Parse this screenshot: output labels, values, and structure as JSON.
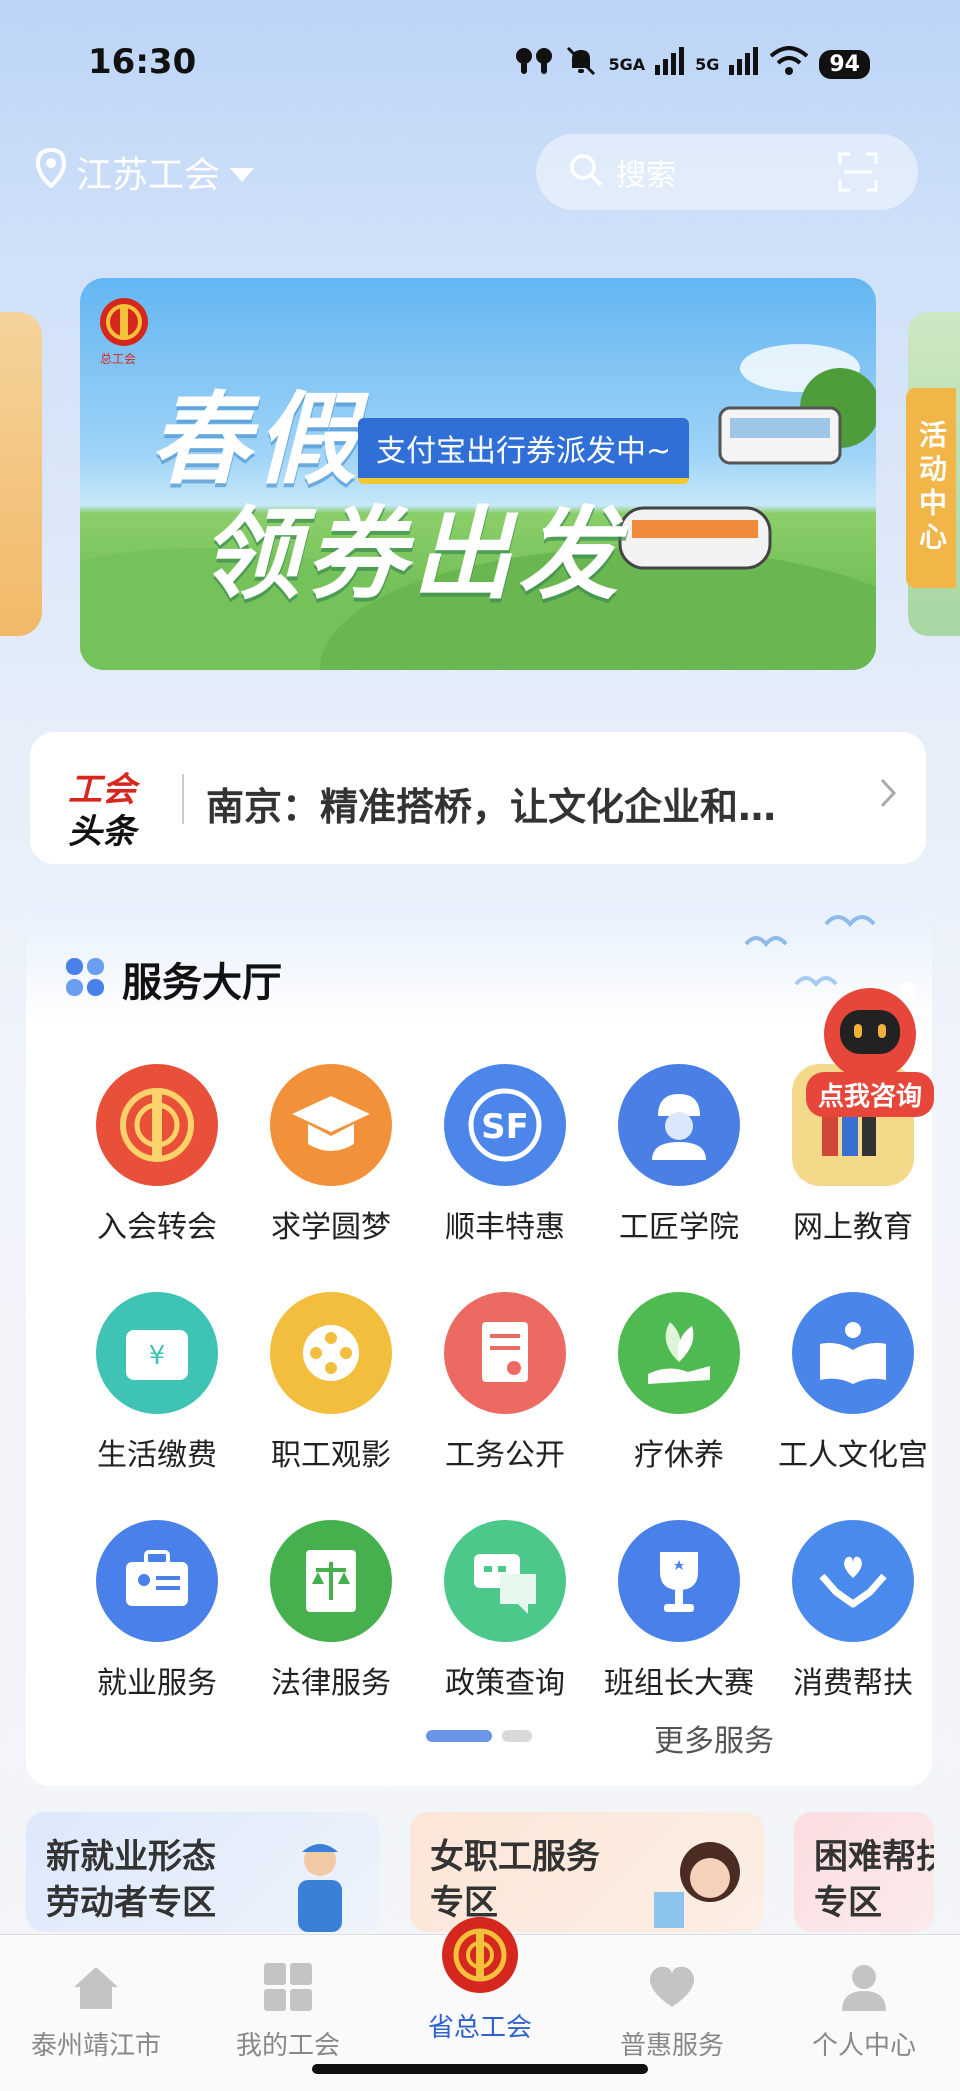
{
  "status_bar": {
    "time": "16:30",
    "network1": "5GA",
    "network2": "5G",
    "battery": "94"
  },
  "header": {
    "location": "江苏工会",
    "search_placeholder": "搜索"
  },
  "banner": {
    "title_line1": "春假",
    "title_line2": "领券出发",
    "subtitle": "支付宝出行券派发中~",
    "logo_text": "总工会"
  },
  "side_tab": {
    "label": "活动中心"
  },
  "headline": {
    "logo_line1": "工会",
    "logo_line2": "头条",
    "text": "南京：精准搭桥，让文化企业和…"
  },
  "service_hall": {
    "title": "服务大厅",
    "items": [
      {
        "label": "入会转会",
        "icon": "union-emblem-icon",
        "color": "#e8503a"
      },
      {
        "label": "求学圆梦",
        "icon": "graduation-cap-icon",
        "color": "#f2913a"
      },
      {
        "label": "顺丰特惠",
        "icon": "sf-logo-icon",
        "color": "#4c86ea"
      },
      {
        "label": "工匠学院",
        "icon": "worker-icon",
        "color": "#4a7fe6"
      },
      {
        "label": "网上教育",
        "icon": "books-icon",
        "color": "#f4d98a"
      },
      {
        "label": "生活缴费",
        "icon": "wallet-icon",
        "color": "#3ec3b4"
      },
      {
        "label": "职工观影",
        "icon": "film-reel-icon",
        "color": "#f3bd3e"
      },
      {
        "label": "工务公开",
        "icon": "document-icon",
        "color": "#ec6a62"
      },
      {
        "label": "疗休养",
        "icon": "leaf-hand-icon",
        "color": "#4fba52"
      },
      {
        "label": "工人文化宫",
        "icon": "open-book-icon",
        "color": "#4a85ea"
      },
      {
        "label": "就业服务",
        "icon": "briefcase-icon",
        "color": "#4a80ea"
      },
      {
        "label": "法律服务",
        "icon": "law-book-icon",
        "color": "#47b04e"
      },
      {
        "label": "政策查询",
        "icon": "chat-bubbles-icon",
        "color": "#4cc98a"
      },
      {
        "label": "班组长大赛",
        "icon": "trophy-icon",
        "color": "#4a80ea"
      },
      {
        "label": "消费帮扶",
        "icon": "heart-hands-icon",
        "color": "#4a8aec"
      }
    ],
    "more": "更多服务"
  },
  "consult": {
    "label": "点我咨询"
  },
  "zones": [
    {
      "line1": "新就业形态",
      "line2": "劳动者专区"
    },
    {
      "line1": "女职工服务",
      "line2": "专区"
    },
    {
      "line1": "困难帮扶",
      "line2": "专区"
    }
  ],
  "nav": [
    {
      "label": "泰州靖江市",
      "icon": "home-icon"
    },
    {
      "label": "我的工会",
      "icon": "grid-icon"
    },
    {
      "label": "省总工会",
      "icon": "union-emblem-icon"
    },
    {
      "label": "普惠服务",
      "icon": "heart-icon"
    },
    {
      "label": "个人中心",
      "icon": "person-icon"
    }
  ],
  "colors": {
    "accent": "#2f62d0",
    "header_bg": "#bcd4f7",
    "union_red": "#d6271f"
  }
}
